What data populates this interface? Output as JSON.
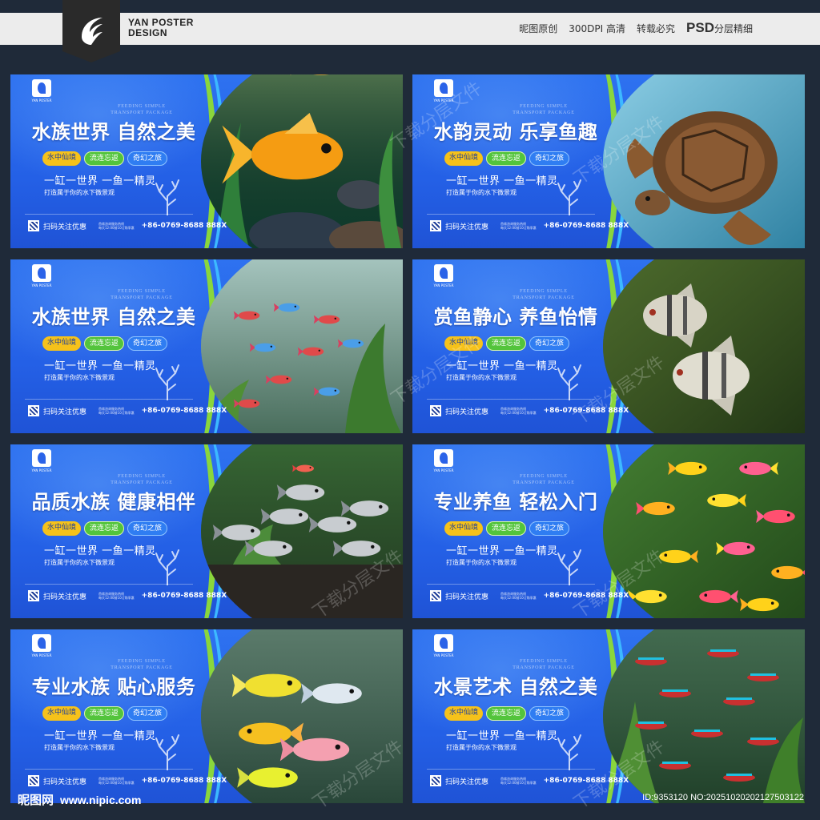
{
  "header": {
    "brand_line1": "YAN POSTER",
    "brand_line2": "DESIGN",
    "links": [
      "昵图原创",
      "300DPI 高清",
      "转载必究"
    ],
    "psd_main": "PSD",
    "psd_sub": "分层精细"
  },
  "banner_common": {
    "logo_tag": "YAN POSTER",
    "en_line1": "FEEDING SIMPLE",
    "en_line2": "TRANSPORT PACKAGE",
    "pills": [
      "水中仙境",
      "流连忘返",
      "奇幻之旅"
    ],
    "slogan": "一缸一世界 一鱼一精灵",
    "subline": "打造属于你的水下微景观",
    "scan": "扫码关注优惠",
    "info_line1": "首席咨询服务热线",
    "info_line2": "每天12:00前10订购享惠",
    "phone": "+86-0769-8688 888X"
  },
  "banners": [
    {
      "title": "水族世界 自然之美",
      "photo": "goldfish"
    },
    {
      "title": "水韵灵动 乐享鱼趣",
      "photo": "turtle"
    },
    {
      "title": "水族世界 自然之美",
      "photo": "guppies"
    },
    {
      "title": "赏鱼静心 养鱼怡情",
      "photo": "angelfish"
    },
    {
      "title": "品质水族 健康相伴",
      "photo": "silver-fish"
    },
    {
      "title": "专业养鱼 轻松入门",
      "photo": "glofish"
    },
    {
      "title": "专业水族 贴心服务",
      "photo": "zebra-danio"
    },
    {
      "title": "水景艺术 自然之美",
      "photo": "neon-tetras"
    }
  ],
  "watermark": "下载分层文件",
  "footer": {
    "site_name": "昵图网",
    "site_url": "www.nipic.com",
    "id_text": "ID:9353120 NO:20251020202127503122"
  },
  "colors": {
    "banner_blue": "#2460e6",
    "arc_green": "#8ad63c",
    "pill_yellow": "#f6c21a",
    "pill_green": "#53c43c",
    "background": "#1f2a39"
  }
}
